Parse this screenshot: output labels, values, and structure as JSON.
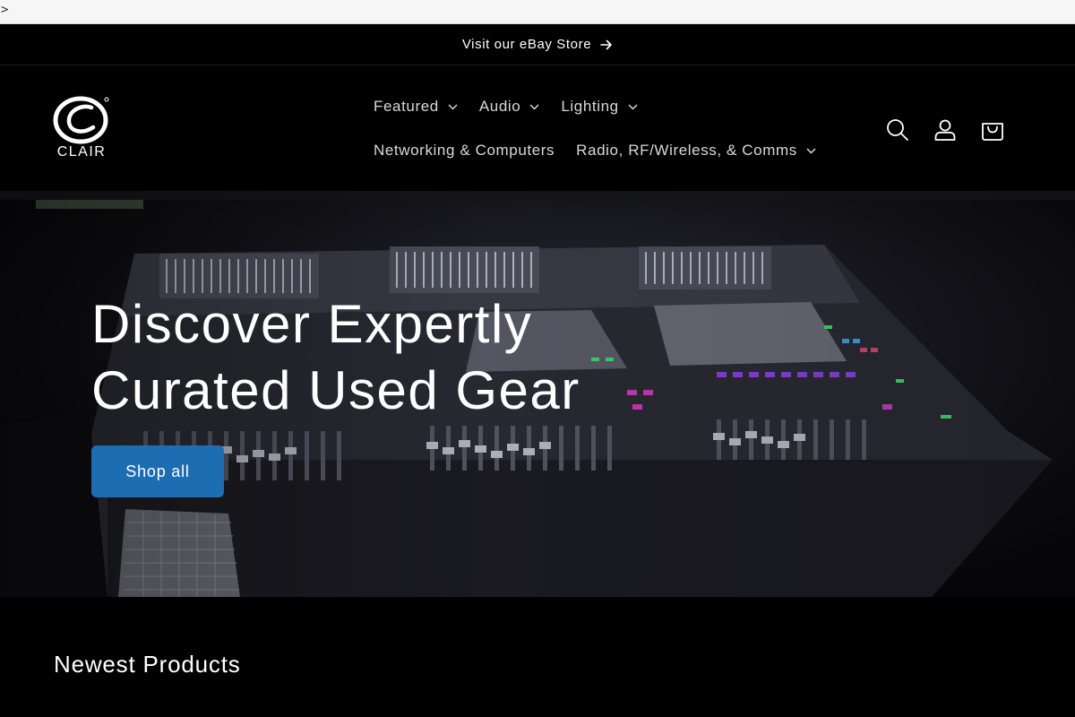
{
  "browser_strip": {
    "glyph": ">"
  },
  "announcement": {
    "text": "Visit our eBay Store"
  },
  "header": {
    "logo_text": "CLAIR",
    "nav_row_1": [
      {
        "label": "Featured"
      },
      {
        "label": "Audio"
      },
      {
        "label": "Lighting"
      }
    ],
    "nav_row_2": [
      {
        "label": "Networking & Computers"
      },
      {
        "label": "Radio, RF/Wireless, & Comms"
      }
    ],
    "icons": [
      "search-icon",
      "account-icon",
      "cart-icon"
    ]
  },
  "hero": {
    "title": "Discover Expertly Curated Used Gear",
    "button_label": "Shop all"
  },
  "sections": {
    "newest_title": "Newest Products"
  },
  "colors": {
    "background": "#000000",
    "accent_button": "#1d6db3",
    "text": "#ffffff",
    "nav_text": "#d8d8d8"
  }
}
